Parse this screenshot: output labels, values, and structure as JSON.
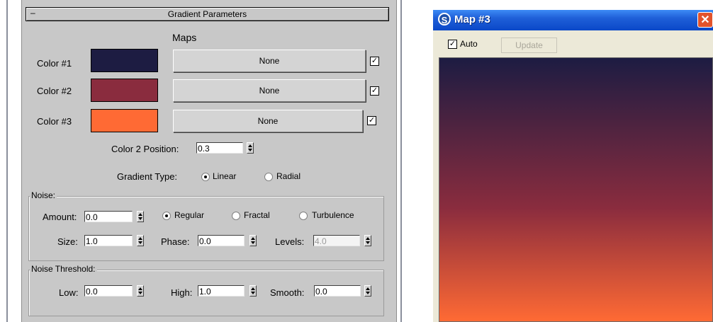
{
  "rollout": {
    "title": "Gradient Parameters",
    "collapse_symbol": "–"
  },
  "maps": {
    "heading": "Maps",
    "rows": [
      {
        "label": "Color #1",
        "color": "#1d1c42",
        "map_label": "None",
        "enabled": true
      },
      {
        "label": "Color #2",
        "color": "#8a2c3e",
        "map_label": "None",
        "enabled": true
      },
      {
        "label": "Color #3",
        "color": "#ff6a34",
        "map_label": "None",
        "enabled": true
      }
    ]
  },
  "color2_position": {
    "label": "Color 2 Position:",
    "value": "0.3"
  },
  "gradient_type": {
    "label": "Gradient Type:",
    "options": [
      "Linear",
      "Radial"
    ],
    "selected": "Linear"
  },
  "noise": {
    "title": "Noise:",
    "amount_label": "Amount:",
    "amount": "0.0",
    "types": [
      "Regular",
      "Fractal",
      "Turbulence"
    ],
    "selected_type": "Regular",
    "size_label": "Size:",
    "size": "1.0",
    "phase_label": "Phase:",
    "phase": "0.0",
    "levels_label": "Levels:",
    "levels": "4.0"
  },
  "noise_threshold": {
    "title": "Noise Threshold:",
    "low_label": "Low:",
    "low": "0.0",
    "high_label": "High:",
    "high": "1.0",
    "smooth_label": "Smooth:",
    "smooth": "0.0"
  },
  "preview_window": {
    "title": "Map #3",
    "auto_label": "Auto",
    "auto_checked": true,
    "update_label": "Update",
    "gradient_colors": [
      "#1d1c42",
      "#8a2c3e",
      "#ff6a34"
    ],
    "color2_position": 0.3
  },
  "icons": {
    "check": "✓",
    "close": "✕",
    "app": "S"
  }
}
